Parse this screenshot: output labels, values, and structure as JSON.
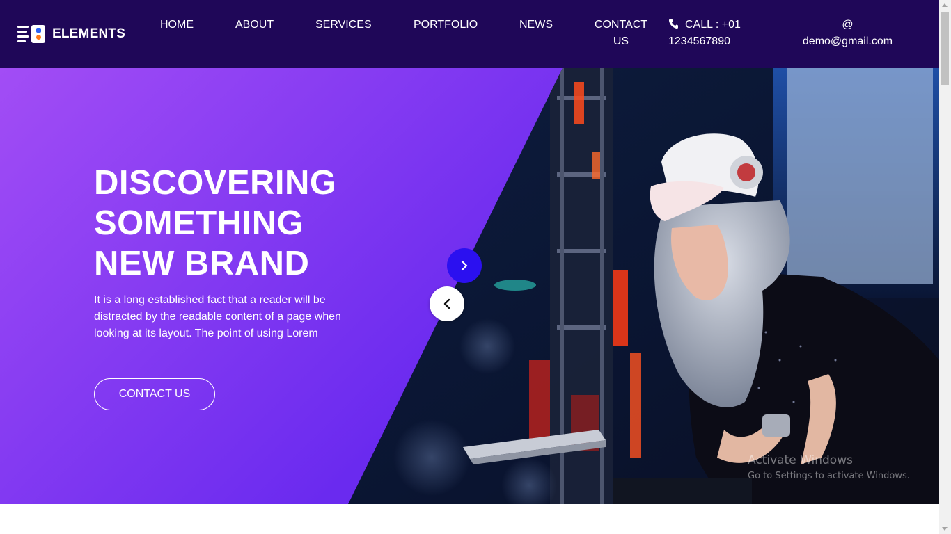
{
  "brand": {
    "name": "ELEMENTS",
    "logo_icon": "logo-mark-icon"
  },
  "nav": {
    "home": "HOME",
    "about": "ABOUT",
    "services": "SERVICES",
    "portfolio": "PORTFOLIO",
    "news": "NEWS",
    "contact_line1": "CONTACT",
    "contact_line2": "US"
  },
  "contact_info": {
    "call_label": "CALL : +01",
    "call_number": "1234567890",
    "phone_icon": "phone-icon",
    "email_at": "@",
    "email": "demo@gmail.com"
  },
  "hero": {
    "title_line1": "DISCOVERING",
    "title_line2": "SOMETHING",
    "title_line3": "NEW BRAND",
    "description": "It is a long established fact that a reader will be distracted by the readable content of a page when looking at its layout. The point of using Lorem",
    "cta_label": "CONTACT US",
    "next_icon": "chevron-right-icon",
    "prev_icon": "chevron-left-icon"
  },
  "watermark": {
    "title": "Activate Windows",
    "subtitle": "Go to Settings to activate Windows."
  },
  "colors": {
    "header_bg": "#1f0758",
    "hero_gradient_start": "#a24df5",
    "hero_gradient_end": "#5a24e6",
    "accent_button": "#2b10f0"
  }
}
